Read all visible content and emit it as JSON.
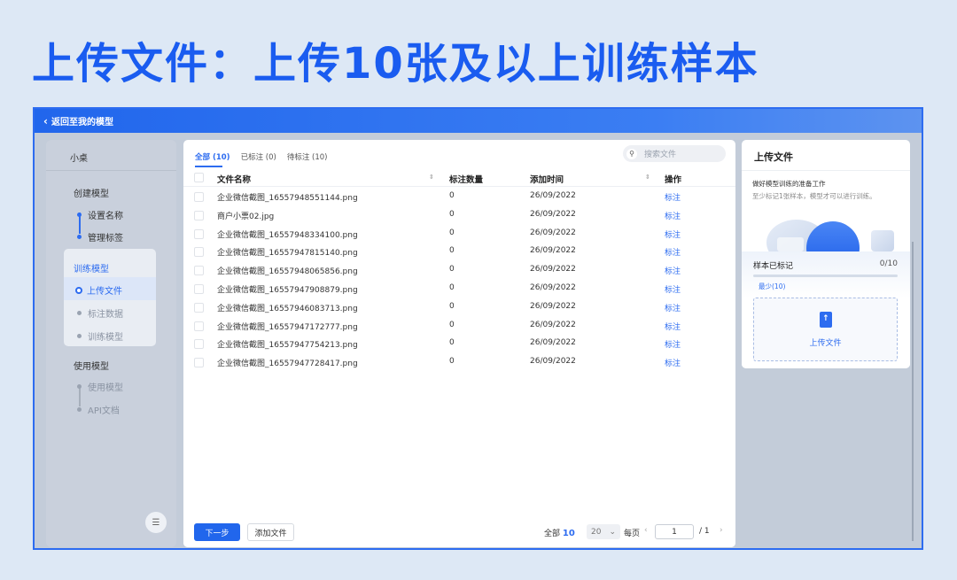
{
  "headline": "上传文件：上传10张及以上训练样本",
  "topbar": {
    "back_label": "返回至我的模型"
  },
  "sidebar": {
    "model_name": "小桌",
    "sections": [
      {
        "title": "创建模型",
        "items": [
          "设置名称",
          "管理标签"
        ]
      },
      {
        "title": "训练模型",
        "items": [
          "上传文件",
          "标注数据",
          "训练模型"
        ]
      },
      {
        "title": "使用模型",
        "items": [
          "使用模型",
          "API文档"
        ]
      }
    ]
  },
  "tabs": [
    "全部 (10)",
    "已标注 (0)",
    "待标注 (10)"
  ],
  "search": {
    "placeholder": "搜索文件"
  },
  "table": {
    "columns": [
      "文件名称",
      "标注数量",
      "添加时间",
      "操作"
    ],
    "rows": [
      {
        "name": "企业微信截图_16557948551144.png",
        "count": "0",
        "date": "26/09/2022",
        "action": "标注"
      },
      {
        "name": "商户小票02.jpg",
        "count": "0",
        "date": "26/09/2022",
        "action": "标注"
      },
      {
        "name": "企业微信截图_16557948334100.png",
        "count": "0",
        "date": "26/09/2022",
        "action": "标注"
      },
      {
        "name": "企业微信截图_16557947815140.png",
        "count": "0",
        "date": "26/09/2022",
        "action": "标注"
      },
      {
        "name": "企业微信截图_16557948065856.png",
        "count": "0",
        "date": "26/09/2022",
        "action": "标注"
      },
      {
        "name": "企业微信截图_16557947908879.png",
        "count": "0",
        "date": "26/09/2022",
        "action": "标注"
      },
      {
        "name": "企业微信截图_16557946083713.png",
        "count": "0",
        "date": "26/09/2022",
        "action": "标注"
      },
      {
        "name": "企业微信截图_16557947172777.png",
        "count": "0",
        "date": "26/09/2022",
        "action": "标注"
      },
      {
        "name": "企业微信截图_16557947754213.png",
        "count": "0",
        "date": "26/09/2022",
        "action": "标注"
      },
      {
        "name": "企业微信截图_16557947728417.png",
        "count": "0",
        "date": "26/09/2022",
        "action": "标注"
      }
    ]
  },
  "footer": {
    "next_label": "下一步",
    "add_label": "添加文件",
    "total_label": "全部",
    "total_value": "10",
    "page_size": "20",
    "per_page_label": "每页",
    "current_page": "1",
    "page_total": "/ 1"
  },
  "upload_panel": {
    "title": "上传文件",
    "line1": "做好模型训练的准备工作",
    "line2": "至少标记1张样本，模型才可以进行训练。",
    "count_label": "样本已标记",
    "count_value": "0/10",
    "progress": 0,
    "minimum_label": "最少(10)",
    "upload_label": "上传文件"
  },
  "colors": {
    "accent": "#2166ec",
    "headline": "#1a5cf0"
  },
  "icons": [
    "chevron-left-icon",
    "search-icon",
    "collapse-menu-icon",
    "file-upload-icon",
    "sort-icon",
    "chevron-down-icon"
  ]
}
